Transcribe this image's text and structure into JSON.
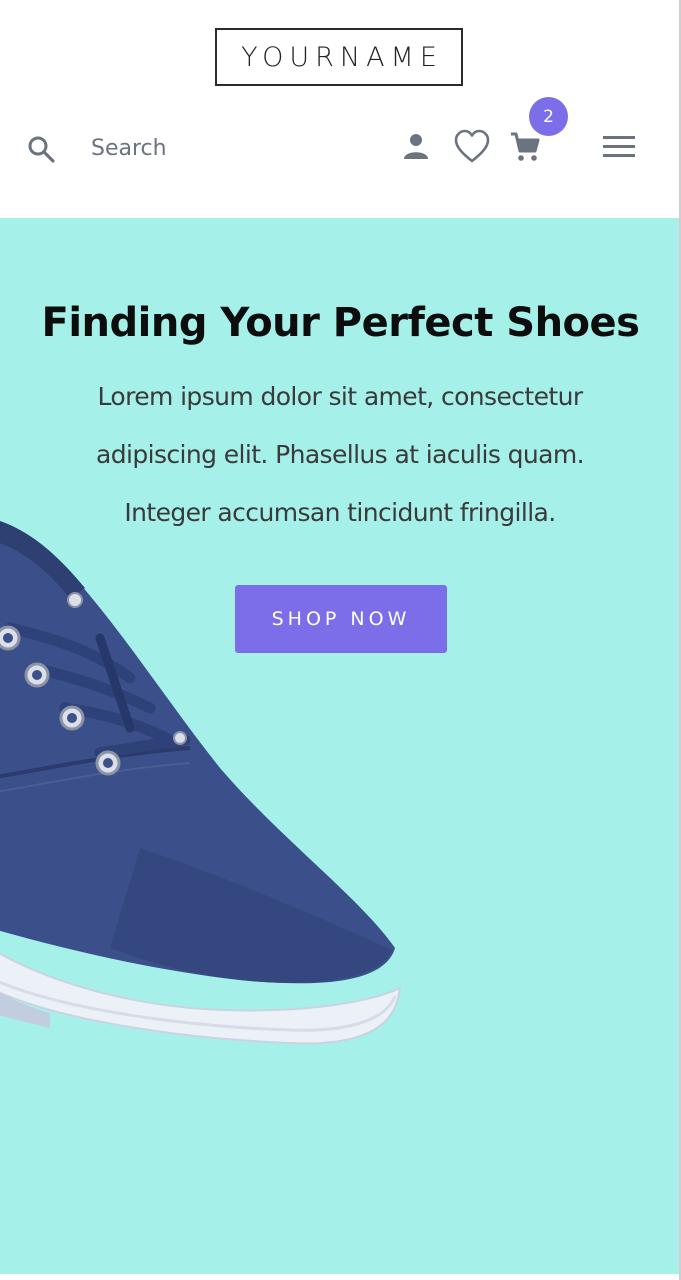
{
  "header": {
    "logo_text": "YOURNAME",
    "search": {
      "label": "Search",
      "icon": "search-icon"
    },
    "icons": {
      "account": "user-icon",
      "wishlist": "heart-icon",
      "cart": "cart-icon",
      "menu": "hamburger-menu-icon"
    },
    "cart_count": "2"
  },
  "hero": {
    "title": "Finding Your Perfect Shoes",
    "description_lines": [
      "Lorem ipsum dolor sit amet, consectetur",
      "adipiscing elit. Phasellus at iaculis quam.",
      "Integer accumsan tincidunt fringilla."
    ],
    "cta_label": "SHOP NOW",
    "image": "blue-canvas-sneaker"
  },
  "colors": {
    "hero_background": "#a6f0ea",
    "accent": "#7b6ee8",
    "text_dark": "#0d0d0d",
    "text_body": "#3a3a3a",
    "icon_gray": "#6b7280"
  }
}
